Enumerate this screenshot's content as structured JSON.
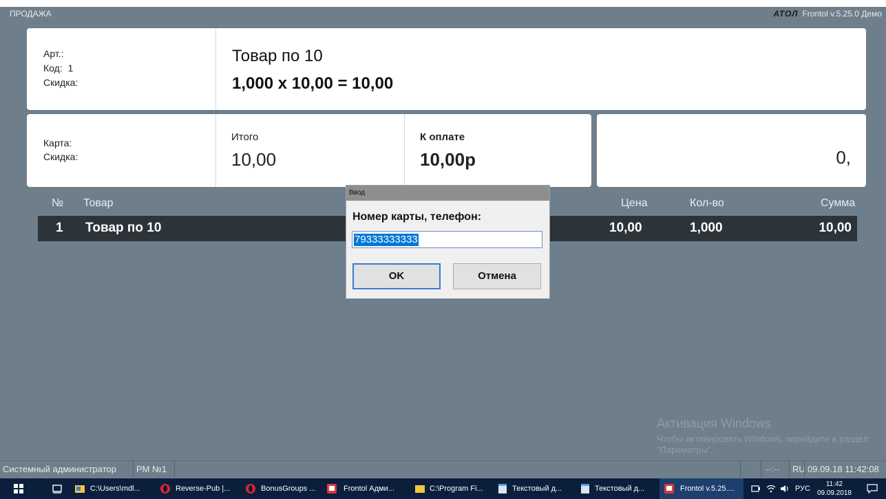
{
  "window": {
    "title": "ПРОДАЖА",
    "brand": "АТОЛ",
    "version": "Frontol v.5.25.0 Демо"
  },
  "item_panel": {
    "art_label": "Арт.:",
    "code_label": "Код:",
    "code_value": "1",
    "discount_label": "Скидка:",
    "product_name": "Товар по 10",
    "calculation": "1,000 x 10,00 = 10,00"
  },
  "totals_panel": {
    "card_label": "Карта:",
    "discount_label": "Скидка:",
    "total_label": "Итого",
    "total_value": "10,00",
    "to_pay_label": "К оплате",
    "to_pay_value": "10,00р"
  },
  "entry_panel": {
    "value": "0,"
  },
  "receipt_table": {
    "headers": {
      "num": "№",
      "product": "Товар",
      "price": "Цена",
      "qty": "Кол-во",
      "sum": "Сумма"
    },
    "rows": [
      {
        "num": "1",
        "product": "Товар по 10",
        "price": "10,00",
        "qty": "1,000",
        "sum": "10,00"
      }
    ]
  },
  "dialog": {
    "title": "Ввод",
    "prompt": "Номер карты, телефон:",
    "input_value": "79333333333",
    "ok_label": "OK",
    "cancel_label": "Отмена"
  },
  "watermark": {
    "line1": "Активация Windows",
    "line2": "Чтобы активировать Windows, перейдите в раздел \"Параметры\"."
  },
  "statusbar": {
    "user": "Системный администратор",
    "workstation": "РМ №1",
    "indicator": "--:--",
    "lang": "RU",
    "datetime": "09.09.18 11:42:08"
  },
  "taskbar": {
    "items": [
      {
        "label": "C:\\Users\\mdl...",
        "icon": "folder-app-icon"
      },
      {
        "label": "Reverse-Pub |...",
        "icon": "opera-icon"
      },
      {
        "label": "BonusGroups ...",
        "icon": "opera-icon"
      },
      {
        "label": "Frontol Адми...",
        "icon": "frontol-icon"
      },
      {
        "label": "C:\\Program Fi...",
        "icon": "folder-icon"
      },
      {
        "label": "Текстовый д...",
        "icon": "notepad-icon"
      },
      {
        "label": "Текстовый д...",
        "icon": "notepad-icon"
      },
      {
        "label": "Frontol v.5.25....",
        "icon": "frontol-icon"
      }
    ],
    "tray_lang": "РУС",
    "clock_time": "11:42",
    "clock_date": "09.09.2018"
  },
  "colors": {
    "background": "#6f7e8b",
    "selected_row": "#2c3339",
    "selection": "#0078d7",
    "taskbar": "#0b1f3d"
  }
}
